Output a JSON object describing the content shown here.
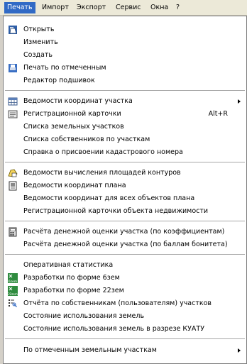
{
  "menubar": [
    {
      "label": "Печать"
    },
    {
      "label": "Импорт"
    },
    {
      "label": "Экспорт"
    },
    {
      "label": "Сервис"
    },
    {
      "label": "Окна"
    },
    {
      "label": "?"
    }
  ],
  "menu": {
    "items": [
      {
        "label": "Открыть",
        "icon": "open-icon"
      },
      {
        "label": "Изменить"
      },
      {
        "label": "Создать"
      },
      {
        "label": "Печать по отмеченным",
        "icon": "print-icon"
      },
      {
        "label": "Редактор подшивок"
      },
      {
        "label": "Ведомости координат участка",
        "icon": "table-icon",
        "submenu": true
      },
      {
        "label": "Регистрационной карточки",
        "icon": "card-icon",
        "shortcut": "Alt+R"
      },
      {
        "label": "Списка земельных участков"
      },
      {
        "label": "Списка собственников по участкам"
      },
      {
        "label": "Справка о присвоении кадастрового номера"
      },
      {
        "label": "Ведомости вычисления площадей контуров",
        "icon": "area-icon"
      },
      {
        "label": "Ведомости координат плана",
        "icon": "plan-icon"
      },
      {
        "label": "Ведомости координат для всех объектов плана"
      },
      {
        "label": "Регистрационной карточки объекта недвижимости"
      },
      {
        "label": "Расчёта денежной оценки участка (по коэффициентам)",
        "icon": "calc-icon"
      },
      {
        "label": "Расчёта денежной оценки участка (по баллам бонитета)"
      },
      {
        "label": "Оперативная статистика"
      },
      {
        "label": "Разработки по форме 6зем",
        "icon": "form-6zem-icon",
        "icon_text": "6zem"
      },
      {
        "label": "Разработки по форме 22зем",
        "icon": "form-22zem-icon",
        "icon_text": "22zem"
      },
      {
        "label": "Отчёта по собственникам (пользователям) участков",
        "icon": "owners-report-icon"
      },
      {
        "label": "Состояние использования земель"
      },
      {
        "label": "Состояние использования земель в разрезе КУАТУ"
      },
      {
        "label": "По отмеченным земельным участкам",
        "submenu": true
      }
    ]
  }
}
